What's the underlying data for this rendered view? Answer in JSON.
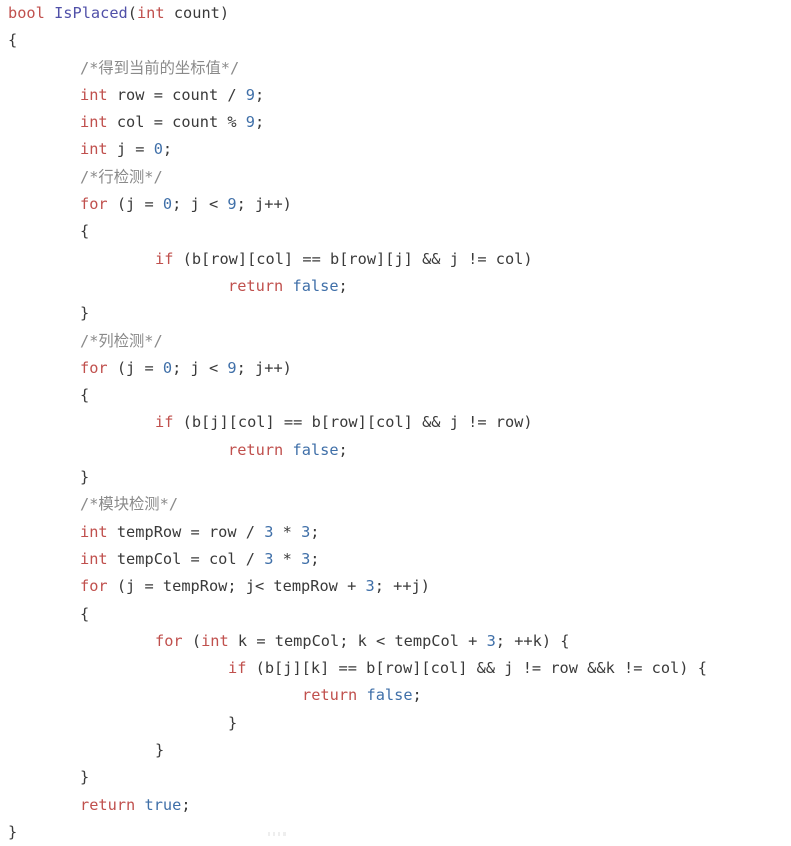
{
  "document": {
    "kind": "source-code-listing",
    "language": "C++",
    "function_name": "IsPlaced",
    "background_color": "#ffffff",
    "colors": {
      "plain": "#3a3a3a",
      "keyword": "#c0504d",
      "function": "#5050a8",
      "number": "#3f6fa8",
      "literal": "#3f6fa8",
      "comment": "#8a8a8a"
    },
    "lines": [
      {
        "indent": 0,
        "tokens": [
          {
            "t": "bool",
            "c": "keyword"
          },
          {
            "t": " ",
            "c": "plain"
          },
          {
            "t": "IsPlaced",
            "c": "func"
          },
          {
            "t": "(",
            "c": "plain"
          },
          {
            "t": "int",
            "c": "keyword"
          },
          {
            "t": " count)",
            "c": "plain"
          }
        ]
      },
      {
        "indent": 0,
        "tokens": [
          {
            "t": "{",
            "c": "plain"
          }
        ]
      },
      {
        "indent": 1,
        "tokens": [
          {
            "t": "/*得到当前的坐标值*/",
            "c": "comment"
          }
        ]
      },
      {
        "indent": 1,
        "tokens": [
          {
            "t": "int",
            "c": "keyword"
          },
          {
            "t": " row = count / ",
            "c": "plain"
          },
          {
            "t": "9",
            "c": "number"
          },
          {
            "t": ";",
            "c": "plain"
          }
        ]
      },
      {
        "indent": 1,
        "tokens": [
          {
            "t": "int",
            "c": "keyword"
          },
          {
            "t": " col = count % ",
            "c": "plain"
          },
          {
            "t": "9",
            "c": "number"
          },
          {
            "t": ";",
            "c": "plain"
          }
        ]
      },
      {
        "indent": 1,
        "tokens": [
          {
            "t": "int",
            "c": "keyword"
          },
          {
            "t": " j = ",
            "c": "plain"
          },
          {
            "t": "0",
            "c": "number"
          },
          {
            "t": ";",
            "c": "plain"
          }
        ]
      },
      {
        "indent": 1,
        "tokens": [
          {
            "t": "/*行检测*/",
            "c": "comment"
          }
        ]
      },
      {
        "indent": 1,
        "tokens": [
          {
            "t": "for",
            "c": "keyword"
          },
          {
            "t": " (j = ",
            "c": "plain"
          },
          {
            "t": "0",
            "c": "number"
          },
          {
            "t": "; j < ",
            "c": "plain"
          },
          {
            "t": "9",
            "c": "number"
          },
          {
            "t": "; j++)",
            "c": "plain"
          }
        ]
      },
      {
        "indent": 1,
        "tokens": [
          {
            "t": "{",
            "c": "plain"
          }
        ]
      },
      {
        "indent": 2,
        "tokens": [
          {
            "t": "if",
            "c": "keyword"
          },
          {
            "t": " (b[row][col] == b[row][j] && j != col)",
            "c": "plain"
          }
        ]
      },
      {
        "indent": 3,
        "tokens": [
          {
            "t": "return",
            "c": "keyword"
          },
          {
            "t": " ",
            "c": "plain"
          },
          {
            "t": "false",
            "c": "literal"
          },
          {
            "t": ";",
            "c": "plain"
          }
        ]
      },
      {
        "indent": 1,
        "tokens": [
          {
            "t": "}",
            "c": "plain"
          }
        ]
      },
      {
        "indent": 1,
        "tokens": [
          {
            "t": "/*列检测*/",
            "c": "comment"
          }
        ]
      },
      {
        "indent": 1,
        "tokens": [
          {
            "t": "for",
            "c": "keyword"
          },
          {
            "t": " (j = ",
            "c": "plain"
          },
          {
            "t": "0",
            "c": "number"
          },
          {
            "t": "; j < ",
            "c": "plain"
          },
          {
            "t": "9",
            "c": "number"
          },
          {
            "t": "; j++)",
            "c": "plain"
          }
        ]
      },
      {
        "indent": 1,
        "tokens": [
          {
            "t": "{",
            "c": "plain"
          }
        ]
      },
      {
        "indent": 2,
        "tokens": [
          {
            "t": "if",
            "c": "keyword"
          },
          {
            "t": " (b[j][col] == b[row][col] && j != row)",
            "c": "plain"
          }
        ]
      },
      {
        "indent": 3,
        "tokens": [
          {
            "t": "return",
            "c": "keyword"
          },
          {
            "t": " ",
            "c": "plain"
          },
          {
            "t": "false",
            "c": "literal"
          },
          {
            "t": ";",
            "c": "plain"
          }
        ]
      },
      {
        "indent": 1,
        "tokens": [
          {
            "t": "}",
            "c": "plain"
          }
        ]
      },
      {
        "indent": 1,
        "tokens": [
          {
            "t": "/*模块检测*/",
            "c": "comment"
          }
        ]
      },
      {
        "indent": 1,
        "tokens": [
          {
            "t": "int",
            "c": "keyword"
          },
          {
            "t": " tempRow = row / ",
            "c": "plain"
          },
          {
            "t": "3",
            "c": "number"
          },
          {
            "t": " * ",
            "c": "plain"
          },
          {
            "t": "3",
            "c": "number"
          },
          {
            "t": ";",
            "c": "plain"
          }
        ]
      },
      {
        "indent": 1,
        "tokens": [
          {
            "t": "int",
            "c": "keyword"
          },
          {
            "t": " tempCol = col / ",
            "c": "plain"
          },
          {
            "t": "3",
            "c": "number"
          },
          {
            "t": " * ",
            "c": "plain"
          },
          {
            "t": "3",
            "c": "number"
          },
          {
            "t": ";",
            "c": "plain"
          }
        ]
      },
      {
        "indent": 1,
        "tokens": [
          {
            "t": "for",
            "c": "keyword"
          },
          {
            "t": " (j = tempRow; j< tempRow + ",
            "c": "plain"
          },
          {
            "t": "3",
            "c": "number"
          },
          {
            "t": "; ++j)",
            "c": "plain"
          }
        ]
      },
      {
        "indent": 1,
        "tokens": [
          {
            "t": "{",
            "c": "plain"
          }
        ]
      },
      {
        "indent": 2,
        "tokens": [
          {
            "t": "for",
            "c": "keyword"
          },
          {
            "t": " (",
            "c": "plain"
          },
          {
            "t": "int",
            "c": "keyword"
          },
          {
            "t": " k = tempCol; k < tempCol + ",
            "c": "plain"
          },
          {
            "t": "3",
            "c": "number"
          },
          {
            "t": "; ++k) {",
            "c": "plain"
          }
        ]
      },
      {
        "indent": 3,
        "tokens": [
          {
            "t": "if",
            "c": "keyword"
          },
          {
            "t": " (b[j][k] == b[row][col] && j != row &&k != col) {",
            "c": "plain"
          }
        ]
      },
      {
        "indent": 4,
        "tokens": [
          {
            "t": "return",
            "c": "keyword"
          },
          {
            "t": " ",
            "c": "plain"
          },
          {
            "t": "false",
            "c": "literal"
          },
          {
            "t": ";",
            "c": "plain"
          }
        ]
      },
      {
        "indent": 3,
        "tokens": [
          {
            "t": "}",
            "c": "plain"
          }
        ]
      },
      {
        "indent": 2,
        "tokens": [
          {
            "t": "}",
            "c": "plain"
          }
        ]
      },
      {
        "indent": 1,
        "tokens": [
          {
            "t": "}",
            "c": "plain"
          }
        ]
      },
      {
        "indent": 1,
        "tokens": [
          {
            "t": "return",
            "c": "keyword"
          },
          {
            "t": " ",
            "c": "plain"
          },
          {
            "t": "true",
            "c": "literal"
          },
          {
            "t": ";",
            "c": "plain"
          }
        ]
      },
      {
        "indent": 0,
        "tokens": [
          {
            "t": "}",
            "c": "plain"
          }
        ]
      }
    ]
  }
}
